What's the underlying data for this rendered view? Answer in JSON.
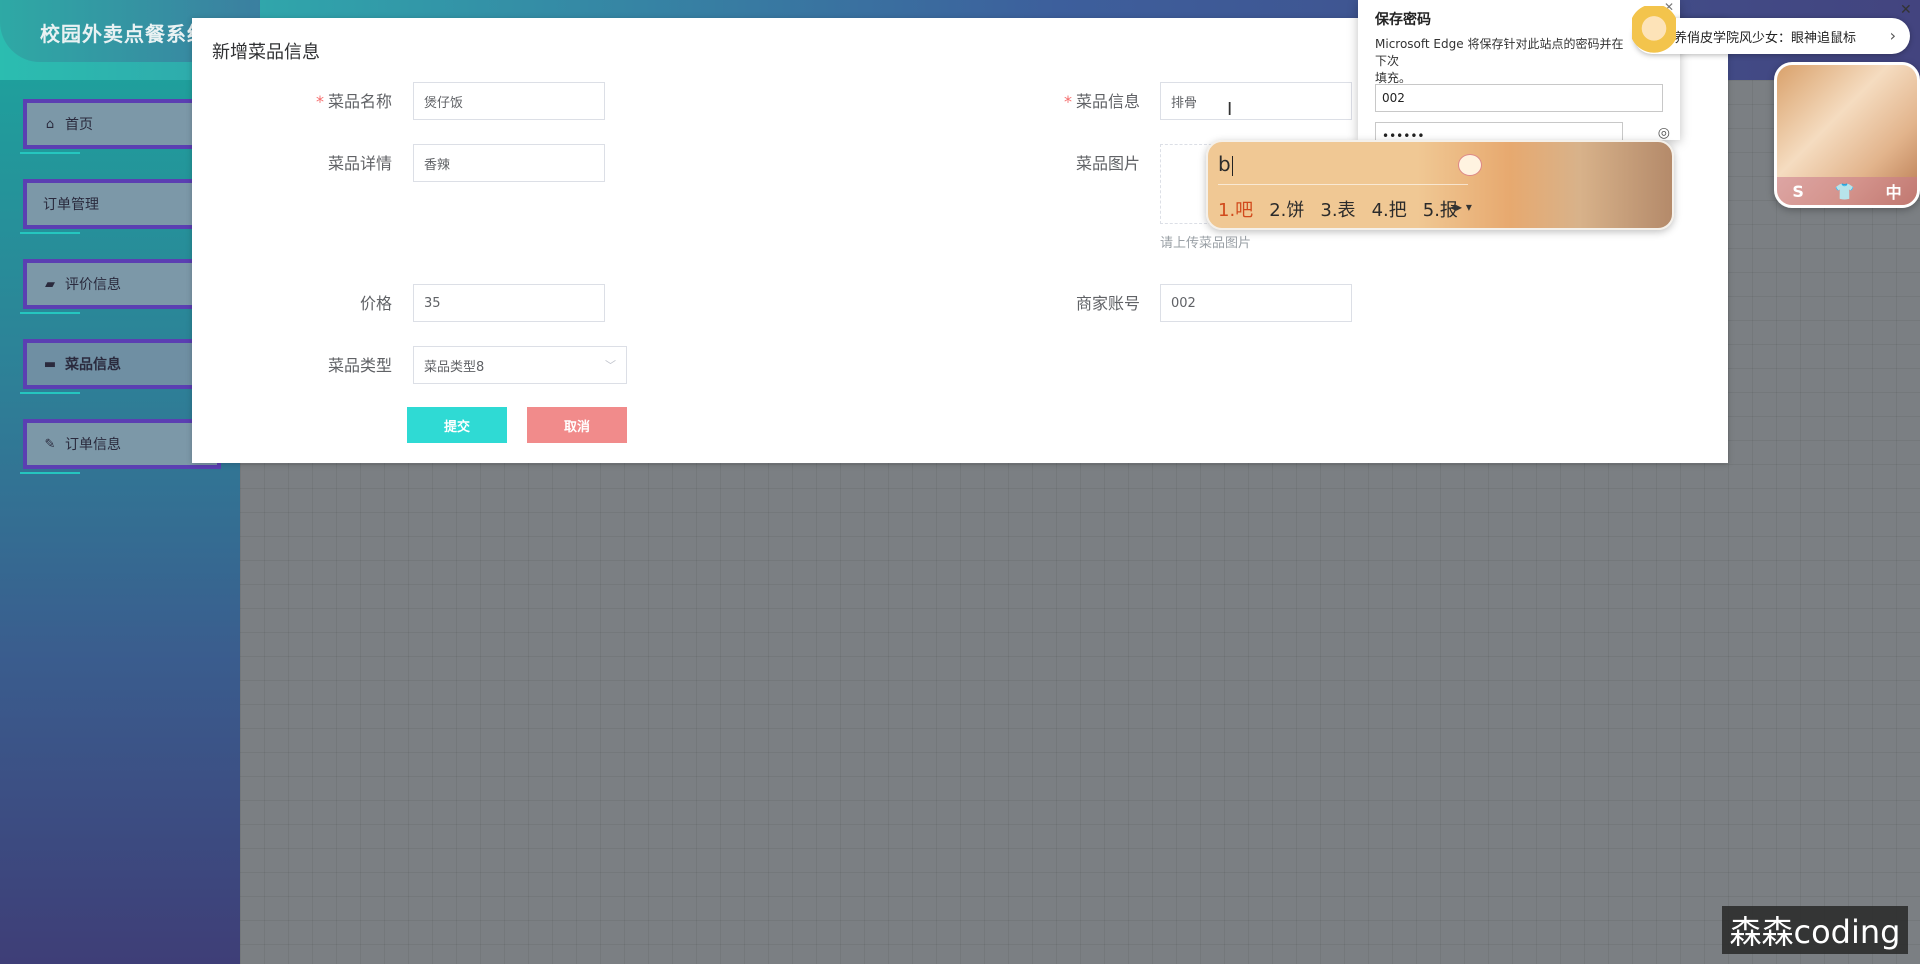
{
  "app": {
    "title": "校园外卖点餐系统"
  },
  "sidebar": {
    "items": [
      {
        "label": "首页",
        "icon": "home-icon",
        "glyph": "⌂"
      },
      {
        "label": "订单管理",
        "icon": "",
        "glyph": ""
      },
      {
        "label": "评价信息",
        "icon": "comment-icon",
        "glyph": "▰"
      },
      {
        "label": "菜品信息",
        "icon": "folder-icon",
        "glyph": "▬"
      },
      {
        "label": "订单信息",
        "icon": "edit-icon",
        "glyph": "✎"
      }
    ]
  },
  "dialog": {
    "title": "新增菜品信息",
    "fields": {
      "name": {
        "label": "菜品名称",
        "value": "煲仔饭",
        "required": true
      },
      "info": {
        "label": "菜品信息",
        "value": "排骨",
        "required": true
      },
      "detail": {
        "label": "菜品详情",
        "value": "香辣"
      },
      "image": {
        "label": "菜品图片",
        "hint": "请上传菜品图片"
      },
      "price": {
        "label": "价格",
        "value": "35"
      },
      "merchant": {
        "label": "商家账号",
        "value": "002"
      },
      "type": {
        "label": "菜品类型",
        "value": "菜品类型8"
      }
    },
    "buttons": {
      "submit": "提交",
      "cancel": "取消"
    }
  },
  "save_password": {
    "title": "保存密码",
    "description": "Microsoft Edge 将保存针对此站点的密码并在下次",
    "description2": "填充。",
    "username": "002",
    "password": "••••••"
  },
  "notification": {
    "text": "养俏皮学院风少女：眼神追鼠标",
    "arrow": "›"
  },
  "ime": {
    "input": "b",
    "candidates": [
      "1.吧",
      "2.饼",
      "3.表",
      "4.把",
      "5.报"
    ],
    "nav": "◂▸ ▾"
  },
  "side_widget": {
    "labels": [
      "S",
      "👕",
      "中"
    ]
  },
  "watermark": "森森coding",
  "colors": {
    "submit": "#2fdad4",
    "cancel": "#f18b8b",
    "required": "#f56c6c"
  }
}
